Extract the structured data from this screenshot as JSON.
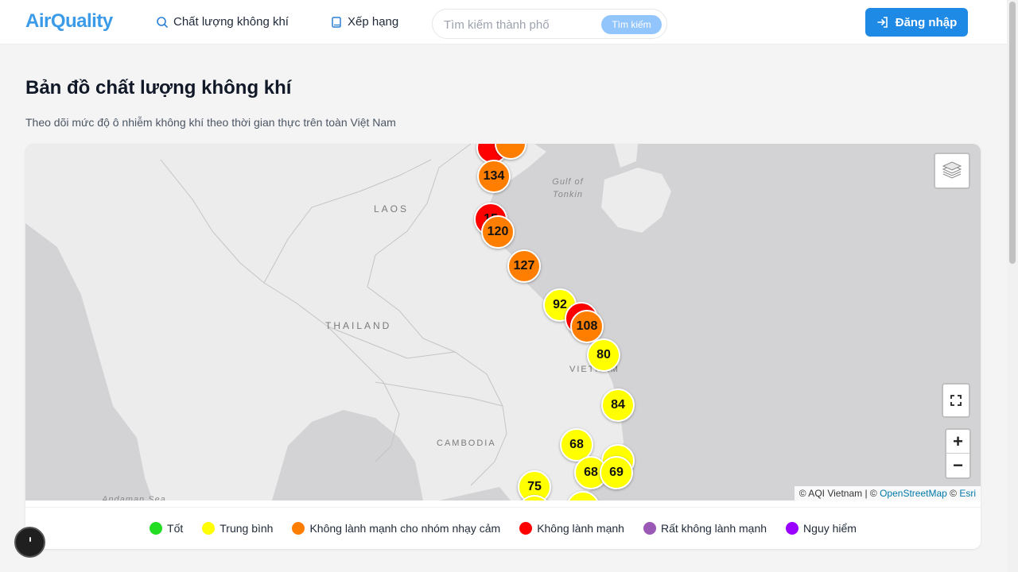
{
  "header": {
    "logo": "AirQuality",
    "nav": [
      {
        "label": "Chất lượng không khí",
        "icon": "search-icon"
      },
      {
        "label": "Xếp hạng",
        "icon": "book-icon"
      }
    ],
    "search": {
      "placeholder": "Tìm kiếm thành phố",
      "button": "Tìm kiếm"
    },
    "login": "Đăng nhập"
  },
  "page": {
    "title": "Bản đồ chất lượng không khí",
    "subtitle": "Theo dõi mức độ ô nhiễm không khí theo thời gian thực trên toàn Việt Nam"
  },
  "map": {
    "labels": {
      "laos": "LAOS",
      "thailand": "THAILAND",
      "cambodia": "CAMBODIA",
      "vietnam": "VIETNAM",
      "gulf": "Gulf of Tonkin",
      "andaman": "Andaman Sea"
    },
    "markers": [
      {
        "value": "",
        "level": "unhealthy"
      },
      {
        "value": "",
        "level": "sensitive"
      },
      {
        "value": "134",
        "level": "sensitive"
      },
      {
        "value": "15",
        "level": "unhealthy"
      },
      {
        "value": "120",
        "level": "sensitive"
      },
      {
        "value": "127",
        "level": "sensitive"
      },
      {
        "value": "92",
        "level": "moderate"
      },
      {
        "value": "",
        "level": "unhealthy"
      },
      {
        "value": "108",
        "level": "sensitive"
      },
      {
        "value": "80",
        "level": "moderate"
      },
      {
        "value": "84",
        "level": "moderate"
      },
      {
        "value": "68",
        "level": "moderate"
      },
      {
        "value": "",
        "level": "moderate"
      },
      {
        "value": "68",
        "level": "moderate"
      },
      {
        "value": "69",
        "level": "moderate"
      },
      {
        "value": "75",
        "level": "moderate"
      },
      {
        "value": "",
        "level": "moderate"
      },
      {
        "value": "",
        "level": "moderate"
      }
    ],
    "controls": {
      "zoom_in": "+",
      "zoom_out": "−"
    },
    "attribution": {
      "prefix": "© AQI Vietnam | © ",
      "osm": "OpenStreetMap",
      "mid": " © ",
      "esri": "Esri"
    }
  },
  "colors": {
    "good": "#22dd22",
    "moderate": "#ffff00",
    "sensitive": "#ff7e00",
    "unhealthy": "#ff0000",
    "very_unhealthy": "#9b59b6",
    "hazardous": "#9900ff"
  },
  "legend": [
    {
      "label": "Tốt",
      "level": "good"
    },
    {
      "label": "Trung bình",
      "level": "moderate"
    },
    {
      "label": "Không lành mạnh cho nhóm nhạy cảm",
      "level": "sensitive"
    },
    {
      "label": "Không lành mạnh",
      "level": "unhealthy"
    },
    {
      "label": "Rất không lành mạnh",
      "level": "very_unhealthy"
    },
    {
      "label": "Nguy hiểm",
      "level": "hazardous"
    }
  ]
}
